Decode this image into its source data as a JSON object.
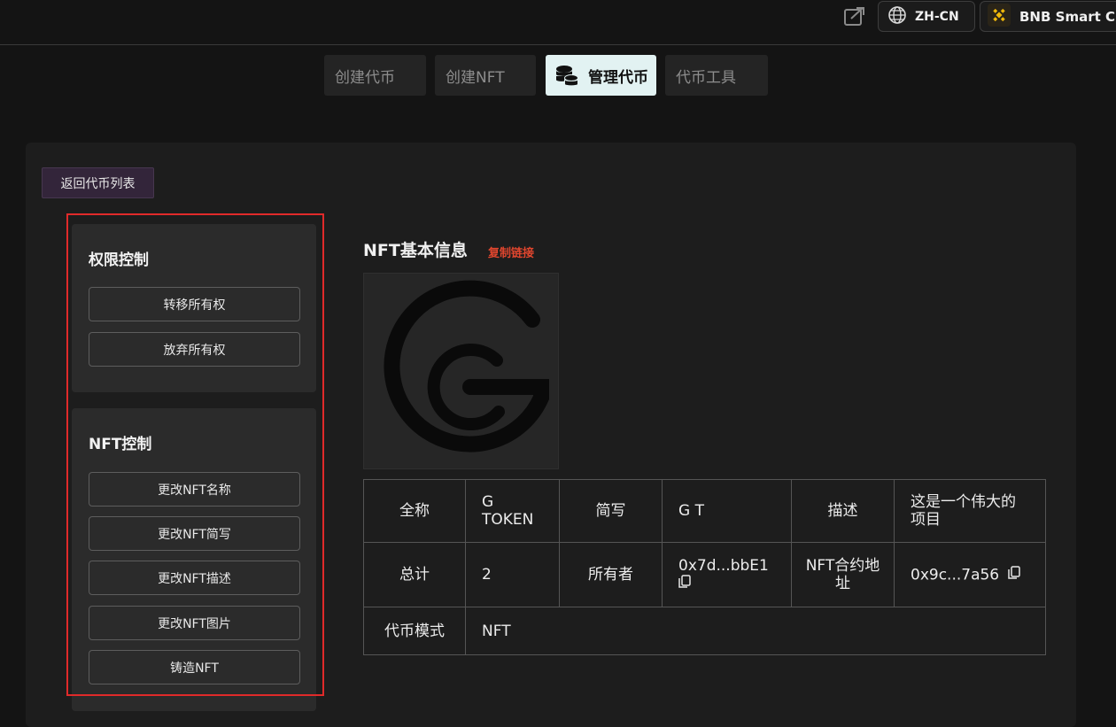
{
  "header": {
    "share_icon": "share-icon",
    "language": "ZH-CN",
    "chain": "BNB Smart Chain",
    "chain_color": "#f0b90b"
  },
  "tabs": [
    {
      "label": "创建代币"
    },
    {
      "label": "创建NFT"
    },
    {
      "label": "管理代币",
      "active": true,
      "icon": "coins-icon"
    },
    {
      "label": "代币工具"
    }
  ],
  "back_button": "返回代币列表",
  "permission_card": {
    "title": "权限控制",
    "buttons": [
      "转移所有权",
      "放弃所有权"
    ]
  },
  "nft_card": {
    "title": "NFT控制",
    "buttons": [
      "更改NFT名称",
      "更改NFT简写",
      "更改NFT描述",
      "更改NFT图片",
      "铸造NFT"
    ]
  },
  "nft_info": {
    "title": "NFT基本信息",
    "copy_link": "复制链接",
    "copy_link_color": "#e0462e",
    "table": {
      "full_name_label": "全称",
      "full_name_value": "G TOKEN",
      "symbol_label": "简写",
      "symbol_value": "G T",
      "description_label": "描述",
      "description_value": "这是一个伟大的项目",
      "total_label": "总计",
      "total_value": "2",
      "owner_label": "所有者",
      "owner_value": "0x7d...bbE1",
      "contract_label": "NFT合约地址",
      "contract_value": "0x9c...7a56",
      "mode_label": "代币模式",
      "mode_value": "NFT"
    }
  }
}
